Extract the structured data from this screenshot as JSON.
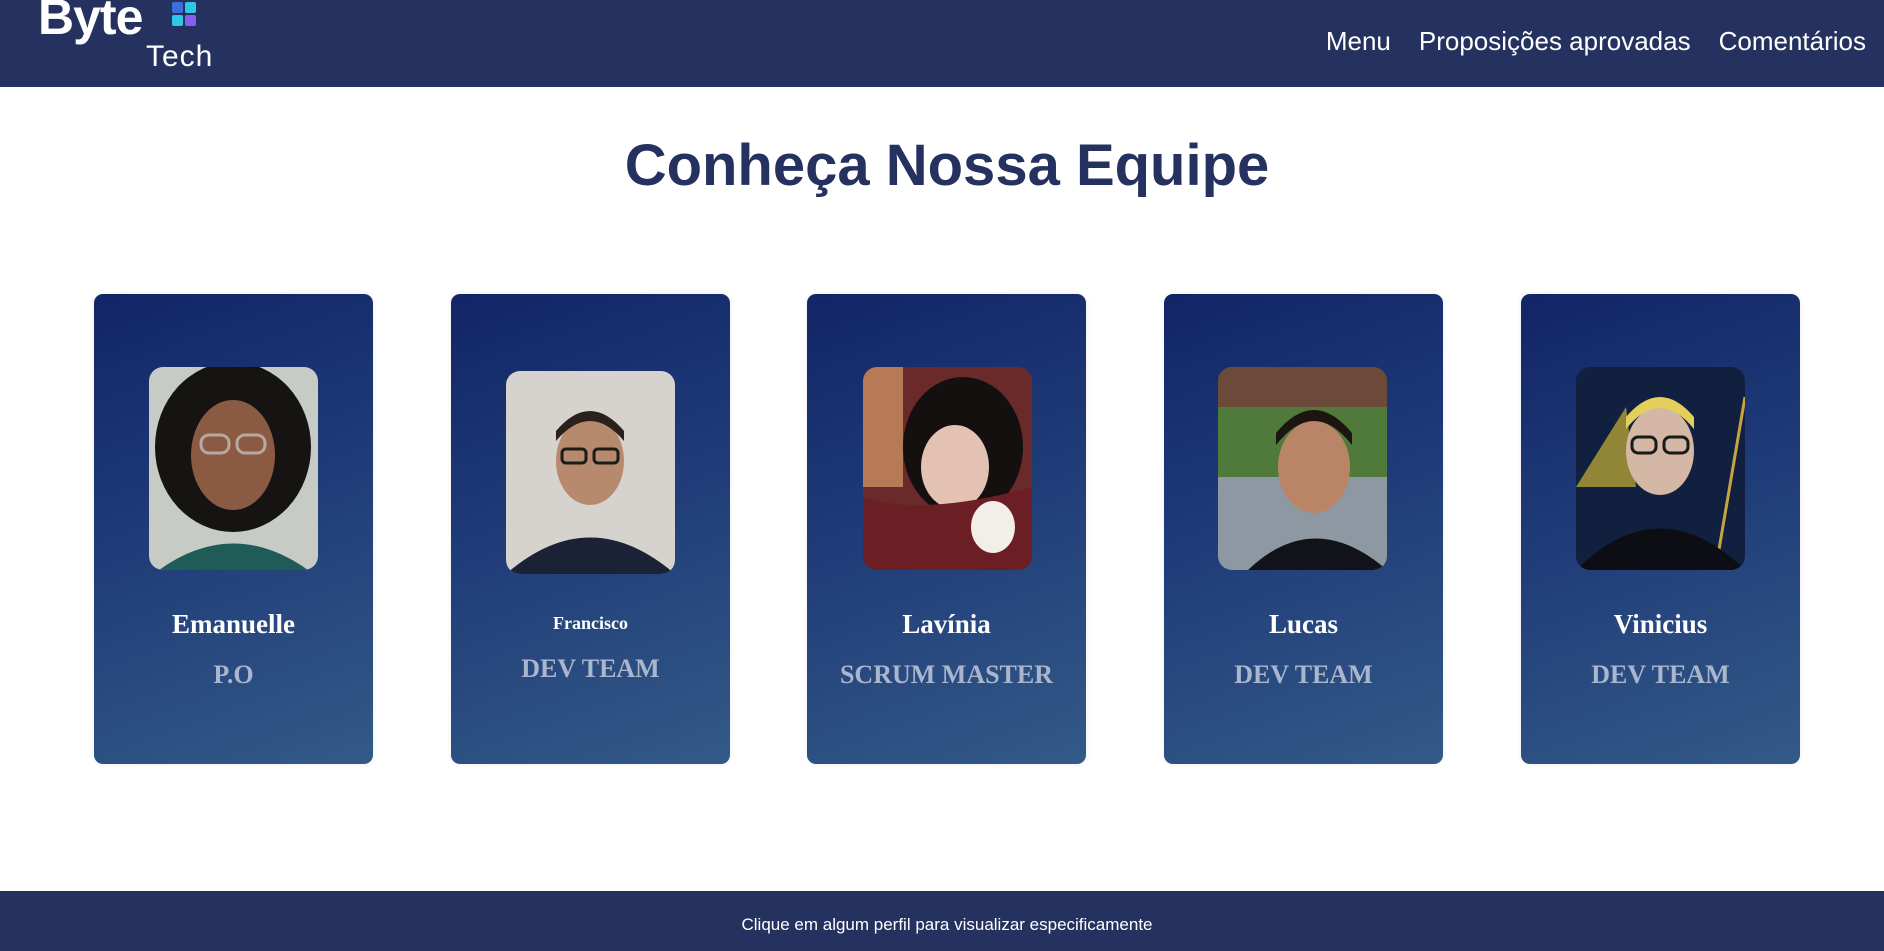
{
  "brand": {
    "logo_main": "Byte",
    "logo_sub": "Tech",
    "colors": {
      "cyan": "#2ec7e6",
      "blue": "#3b6fe0",
      "purple": "#8a5cf0"
    }
  },
  "nav": {
    "items": [
      {
        "label": "Menu"
      },
      {
        "label": "Proposições aprovadas"
      },
      {
        "label": "Comentários"
      }
    ]
  },
  "main": {
    "title": "Conheça Nossa Equipe",
    "team": [
      {
        "name": "Emanuelle",
        "role": "P.O",
        "photo": "profile-photo"
      },
      {
        "name": "Francisco",
        "role": "DEV TEAM",
        "photo": "profile-photo"
      },
      {
        "name": "Lavínia",
        "role": "SCRUM MASTER",
        "photo": "profile-photo"
      },
      {
        "name": "Lucas",
        "role": "DEV TEAM",
        "photo": "profile-photo"
      },
      {
        "name": "Vinicius",
        "role": "DEV TEAM",
        "photo": "profile-photo"
      }
    ]
  },
  "footer": {
    "text": "Clique em algum perfil para visualizar especificamente"
  },
  "theme": {
    "header_bg": "#25315e",
    "title_color": "#25315e",
    "card_gradient": [
      "#122566",
      "#335a87"
    ],
    "role_color": "#a9b6cd"
  }
}
